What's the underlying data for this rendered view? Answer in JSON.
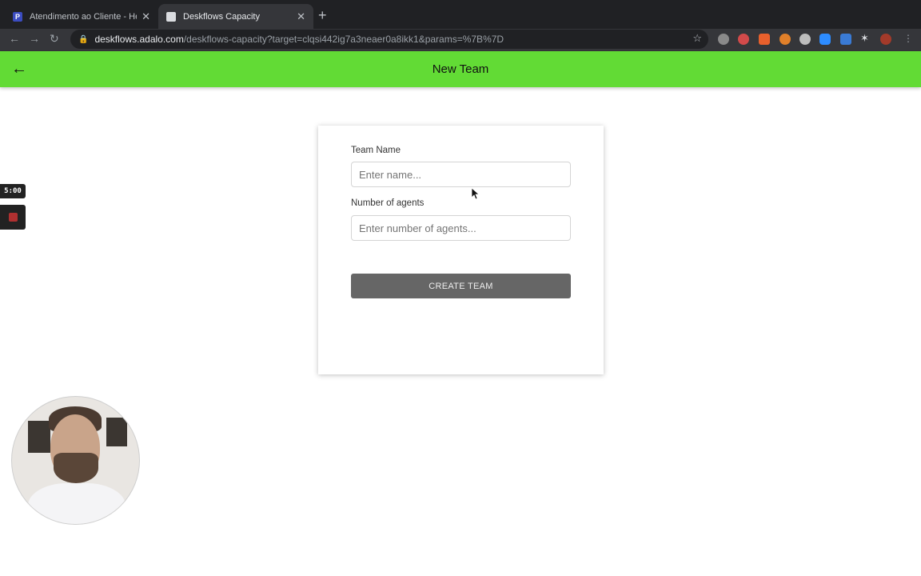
{
  "browser": {
    "tabs": [
      {
        "favicon": "P",
        "title": "Atendimento ao Cliente - Helpd",
        "close": "✕"
      },
      {
        "favicon": "",
        "title": "Deskflows Capacity",
        "close": "✕"
      }
    ],
    "new_tab": "+",
    "url_host": "deskflows.adalo.com",
    "url_path": "/deskflows-capacity?target=clqsi442ig7a3neaer0a8ikk1&params=%7B%7D",
    "extension_colors": [
      "#8a8a8a",
      "#d24a4a",
      "#e8602c",
      "#e0802a",
      "#bdbdbd",
      "#2d8cff",
      "#3a7bd5",
      "#dadce0",
      "#a33a2a"
    ]
  },
  "app": {
    "title": "New Team",
    "accent_color": "#62db35",
    "form": {
      "team_name_label": "Team Name",
      "team_name_placeholder": "Enter name...",
      "agents_label": "Number of agents",
      "agents_placeholder": "Enter number of agents...",
      "submit_label": "CREATE TEAM"
    }
  },
  "recorder": {
    "timer": "5:00"
  }
}
